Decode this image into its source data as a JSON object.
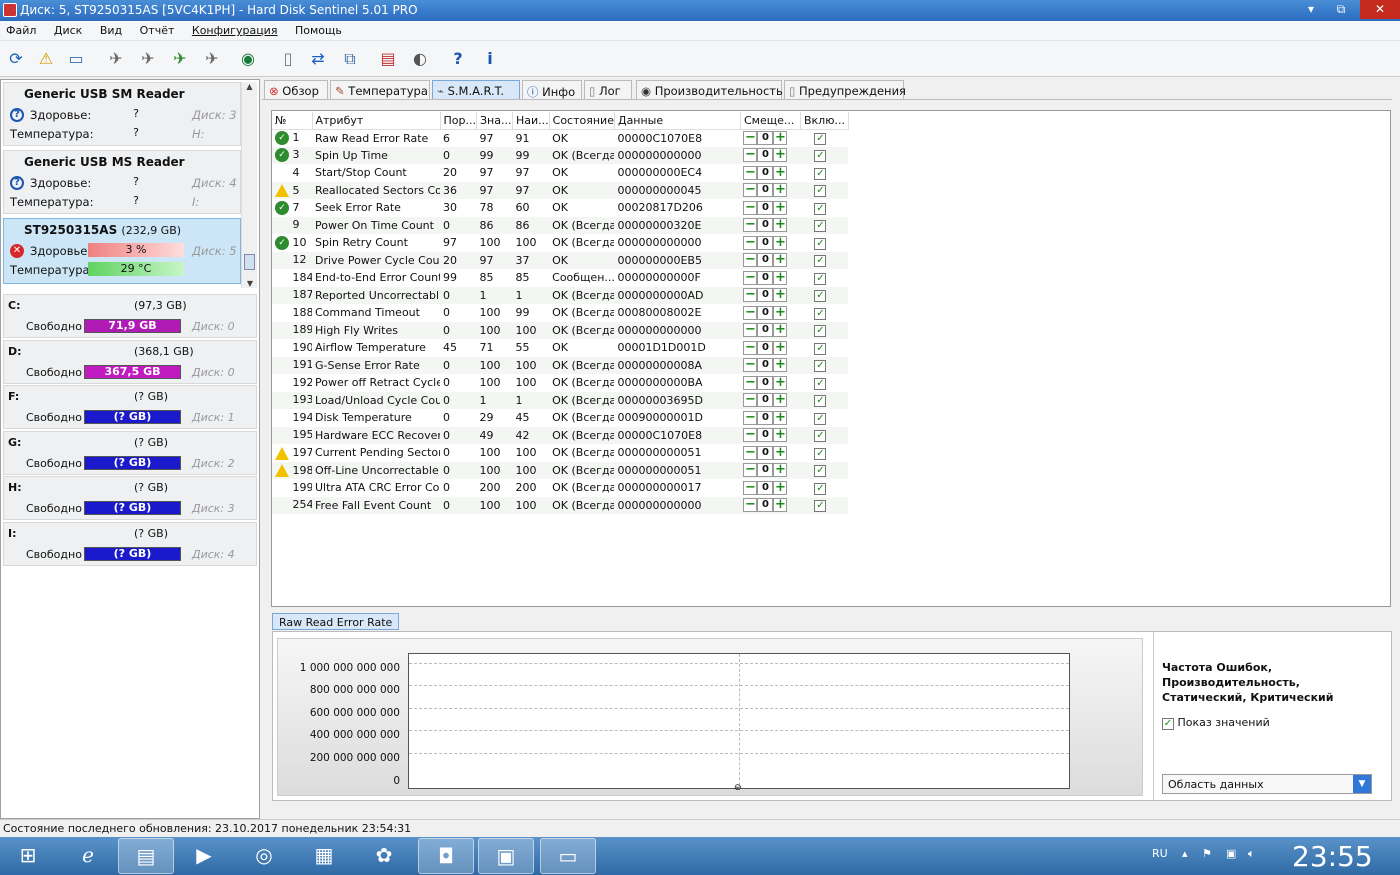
{
  "window": {
    "title": "Диск: 5, ST9250315AS [5VC4K1PH]  -  Hard Disk Sentinel 5.01 PRO",
    "controls": [
      "▾",
      "⧉",
      "✕"
    ]
  },
  "menu": [
    "Файл",
    "Диск",
    "Вид",
    "Отчёт",
    "Конфигурация",
    "Помощь"
  ],
  "toolbar": [
    "refresh-icon",
    "warning-icon",
    "disk-icon",
    "satellite-icon",
    "satellite-icon",
    "satellite-icon",
    "satellite-icon",
    "globe-icon",
    "document-icon",
    "sync-icon",
    "network-icon",
    "report-icon",
    "speaker-icon",
    "help-icon",
    "info-icon"
  ],
  "devices": [
    {
      "name": "Generic USB SM Reader",
      "health_label": "Здоровье:",
      "health": "?",
      "temp_label": "Температура:",
      "temp": "?",
      "disk": "Диск: 3",
      "letter": "H:"
    },
    {
      "name": "Generic USB MS Reader",
      "health_label": "Здоровье:",
      "health": "?",
      "temp_label": "Температура:",
      "temp": "?",
      "disk": "Диск: 4",
      "letter": "I:"
    },
    {
      "name": "ST9250315AS",
      "size": "(232,9 GB)",
      "health_label": "Здоровье:",
      "health": "3 %",
      "temp_label": "Температура:",
      "temp": "29 °C",
      "disk": "Диск: 5"
    }
  ],
  "volumes": [
    {
      "letter": "C:",
      "size": "(97,3 GB)",
      "free_label": "Свободно",
      "free": "71,9 GB",
      "disk": "Диск: 0",
      "color": "#b01ab5"
    },
    {
      "letter": "D:",
      "size": "(368,1 GB)",
      "free_label": "Свободно",
      "free": "367,5 GB",
      "disk": "Диск: 0",
      "color": "#c01ac0"
    },
    {
      "letter": "F:",
      "size": "(? GB)",
      "free_label": "Свободно",
      "free": "(? GB)",
      "disk": "Диск: 1",
      "color": "#1a1acc"
    },
    {
      "letter": "G:",
      "size": "(? GB)",
      "free_label": "Свободно",
      "free": "(? GB)",
      "disk": "Диск: 2",
      "color": "#1a1acc"
    },
    {
      "letter": "H:",
      "size": "(? GB)",
      "free_label": "Свободно",
      "free": "(? GB)",
      "disk": "Диск: 3",
      "color": "#1a1acc"
    },
    {
      "letter": "I:",
      "size": "(? GB)",
      "free_label": "Свободно",
      "free": "(? GB)",
      "disk": "Диск: 4",
      "color": "#1a1acc"
    }
  ],
  "tabs": [
    "Обзор",
    "Температура",
    "S.M.A.R.T.",
    "Инфо",
    "Лог",
    "Производительность",
    "Предупреждения"
  ],
  "smart": {
    "columns": [
      "№",
      "Атрибут",
      "Пор...",
      "Зна...",
      "Наи...",
      "Состояние",
      "Данные",
      "Смеще...",
      "Вклю..."
    ],
    "rows": [
      {
        "status": "ok",
        "id": "1",
        "name": "Raw Read Error Rate",
        "thr": "6",
        "val": "97",
        "worst": "91",
        "state": "OK",
        "data": "00000C1070E8",
        "offset": "0"
      },
      {
        "status": "ok",
        "id": "3",
        "name": "Spin Up Time",
        "thr": "0",
        "val": "99",
        "worst": "99",
        "state": "OK (Всегда...",
        "data": "000000000000",
        "offset": "0"
      },
      {
        "status": "",
        "id": "4",
        "name": "Start/Stop Count",
        "thr": "20",
        "val": "97",
        "worst": "97",
        "state": "OK",
        "data": "000000000EC4",
        "offset": "0"
      },
      {
        "status": "warn",
        "id": "5",
        "name": "Reallocated Sectors Co...",
        "thr": "36",
        "val": "97",
        "worst": "97",
        "state": "OK",
        "data": "000000000045",
        "offset": "0"
      },
      {
        "status": "ok",
        "id": "7",
        "name": "Seek Error Rate",
        "thr": "30",
        "val": "78",
        "worst": "60",
        "state": "OK",
        "data": "00020817D206",
        "offset": "0"
      },
      {
        "status": "",
        "id": "9",
        "name": "Power On Time Count",
        "thr": "0",
        "val": "86",
        "worst": "86",
        "state": "OK (Всегда...",
        "data": "00000000320E",
        "offset": "0"
      },
      {
        "status": "ok",
        "id": "10",
        "name": "Spin Retry Count",
        "thr": "97",
        "val": "100",
        "worst": "100",
        "state": "OK (Всегда...",
        "data": "000000000000",
        "offset": "0"
      },
      {
        "status": "",
        "id": "12",
        "name": "Drive Power Cycle Count",
        "thr": "20",
        "val": "97",
        "worst": "37",
        "state": "OK",
        "data": "000000000EB5",
        "offset": "0"
      },
      {
        "status": "",
        "id": "184",
        "name": "End-to-End Error Count",
        "thr": "99",
        "val": "85",
        "worst": "85",
        "state": "Сообщен...",
        "data": "00000000000F",
        "offset": "0"
      },
      {
        "status": "",
        "id": "187",
        "name": "Reported Uncorrectabl...",
        "thr": "0",
        "val": "1",
        "worst": "1",
        "state": "OK (Всегда...",
        "data": "0000000000AD",
        "offset": "0"
      },
      {
        "status": "",
        "id": "188",
        "name": "Command Timeout",
        "thr": "0",
        "val": "100",
        "worst": "99",
        "state": "OK (Всегда...",
        "data": "00080008002E",
        "offset": "0"
      },
      {
        "status": "",
        "id": "189",
        "name": "High Fly Writes",
        "thr": "0",
        "val": "100",
        "worst": "100",
        "state": "OK (Всегда...",
        "data": "000000000000",
        "offset": "0"
      },
      {
        "status": "",
        "id": "190",
        "name": "Airflow Temperature",
        "thr": "45",
        "val": "71",
        "worst": "55",
        "state": "OK",
        "data": "00001D1D001D",
        "offset": "0"
      },
      {
        "status": "",
        "id": "191",
        "name": "G-Sense Error Rate",
        "thr": "0",
        "val": "100",
        "worst": "100",
        "state": "OK (Всегда...",
        "data": "00000000008A",
        "offset": "0"
      },
      {
        "status": "",
        "id": "192",
        "name": "Power off Retract Cycle ...",
        "thr": "0",
        "val": "100",
        "worst": "100",
        "state": "OK (Всегда...",
        "data": "0000000000BA",
        "offset": "0"
      },
      {
        "status": "",
        "id": "193",
        "name": "Load/Unload Cycle Cou...",
        "thr": "0",
        "val": "1",
        "worst": "1",
        "state": "OK (Всегда...",
        "data": "00000003695D",
        "offset": "0"
      },
      {
        "status": "",
        "id": "194",
        "name": "Disk Temperature",
        "thr": "0",
        "val": "29",
        "worst": "45",
        "state": "OK (Всегда...",
        "data": "00090000001D",
        "offset": "0"
      },
      {
        "status": "",
        "id": "195",
        "name": "Hardware ECC Recovered",
        "thr": "0",
        "val": "49",
        "worst": "42",
        "state": "OK (Всегда...",
        "data": "00000C1070E8",
        "offset": "0"
      },
      {
        "status": "warn",
        "id": "197",
        "name": "Current Pending Sector...",
        "thr": "0",
        "val": "100",
        "worst": "100",
        "state": "OK (Всегда...",
        "data": "000000000051",
        "offset": "0"
      },
      {
        "status": "warn",
        "id": "198",
        "name": "Off-Line Uncorrectable ...",
        "thr": "0",
        "val": "100",
        "worst": "100",
        "state": "OK (Всегда...",
        "data": "000000000051",
        "offset": "0"
      },
      {
        "status": "",
        "id": "199",
        "name": "Ultra ATA CRC Error Co...",
        "thr": "0",
        "val": "200",
        "worst": "200",
        "state": "OK (Всегда...",
        "data": "000000000017",
        "offset": "0"
      },
      {
        "status": "",
        "id": "254",
        "name": "Free Fall Event Count",
        "thr": "0",
        "val": "100",
        "worst": "100",
        "state": "OK (Всегда...",
        "data": "000000000000",
        "offset": "0"
      }
    ]
  },
  "chart": {
    "tab_label": "Raw Read Error Rate",
    "y_ticks": [
      "1 000 000 000 000",
      "800 000 000 000",
      "600 000 000 000",
      "400 000 000 000",
      "200 000 000 000",
      "0"
    ],
    "legend_title": "Частота Ошибок, Производительность, Статический, Критический",
    "show_values_label": "Показ значений",
    "area_select": "Область данных"
  },
  "status_text": "Состояние последнего обновления: 23.10.2017 понедельник 23:54:31",
  "taskbar": {
    "lang": "RU",
    "clock": "23:55"
  }
}
